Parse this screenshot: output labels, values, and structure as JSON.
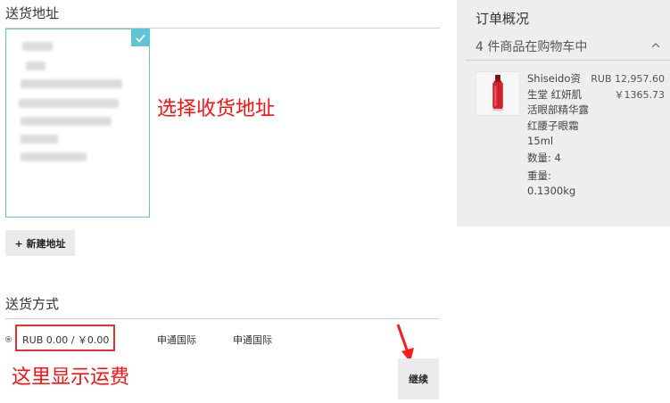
{
  "address_section": {
    "title": "送货地址",
    "annotation": "选择收货地址",
    "new_address_button": "+ 新建地址"
  },
  "shipping_section": {
    "title": "送货方式",
    "price": "RUB 0.00 / ￥0.00",
    "carrier": "申通国际",
    "method": "申通国际",
    "annotation": "这里显示运费",
    "continue_button": "继续"
  },
  "summary": {
    "title": "订单概况",
    "items_count": "4 件商品在购物车中",
    "product": {
      "name": "Shiseido资生堂 红妍肌活眼部精华露 红腰子眼霜 15ml",
      "price_rub": "RUB 12,957.60",
      "price_cny": "￥1365.73",
      "quantity": "数量: 4",
      "weight_label": "重量:",
      "weight_value": "0.1300kg"
    }
  },
  "colors": {
    "accent": "#5fc4d6",
    "annotation_red": "#ff0f0f",
    "summary_bg": "#eeeeee"
  }
}
